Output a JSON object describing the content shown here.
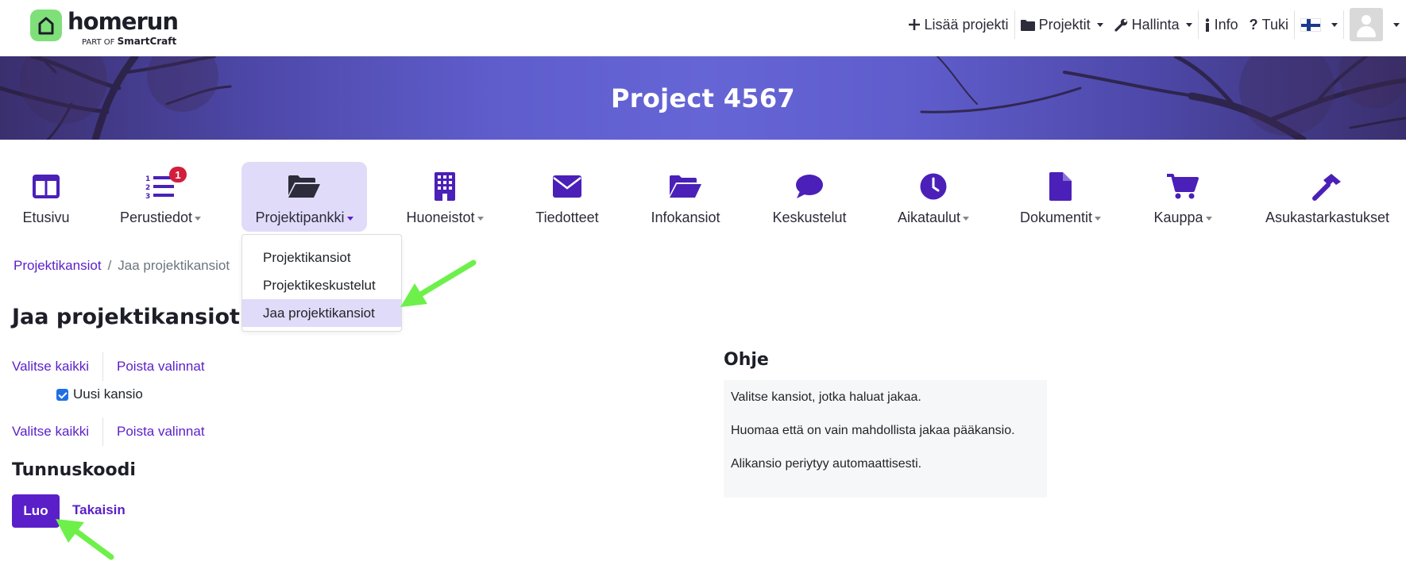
{
  "brand": {
    "name": "homerun",
    "tagline_prefix": "PART OF",
    "tagline_company": "SmartCraft",
    "accent": "#7fe07a"
  },
  "topnav": {
    "items": [
      {
        "label": "Lisää projekti",
        "icon": "plus-icon"
      },
      {
        "label": "Projektit",
        "icon": "folder-icon"
      },
      {
        "label": "Hallinta",
        "icon": "wrench-icon"
      },
      {
        "label": "Info",
        "icon": "info-icon"
      },
      {
        "label": "Tuki",
        "icon": "question-icon"
      }
    ],
    "language_icon": "finnish-flag-icon",
    "user_icon": "user-avatar-icon"
  },
  "hero": {
    "title": "Project 4567"
  },
  "mainnav": {
    "items": [
      {
        "label": "Etusivu",
        "icon": "columns-icon"
      },
      {
        "label": "Perustiedot",
        "icon": "numbered-list-icon",
        "badge": "1"
      },
      {
        "label": "Projektipankki",
        "icon": "folder-open-icon"
      },
      {
        "label": "Huoneistot",
        "icon": "building-icon"
      },
      {
        "label": "Tiedotteet",
        "icon": "envelope-icon"
      },
      {
        "label": "Infokansiot",
        "icon": "folder-open-icon"
      },
      {
        "label": "Keskustelut",
        "icon": "speech-bubble-icon"
      },
      {
        "label": "Aikataulut",
        "icon": "clock-icon"
      },
      {
        "label": "Dokumentit",
        "icon": "file-icon"
      },
      {
        "label": "Kauppa",
        "icon": "cart-icon"
      },
      {
        "label": "Asukastarkastukset",
        "icon": "hammer-icon"
      }
    ],
    "active": "Projektipankki"
  },
  "dropdown": {
    "items": [
      "Projektikansiot",
      "Projektikeskustelut",
      "Jaa projektikansiot"
    ],
    "selected": "Jaa projektikansiot"
  },
  "breadcrumb": {
    "parent": "Projektikansiot",
    "separator": "/",
    "current": "Jaa projektikansiot"
  },
  "page": {
    "title": "Jaa projektikansiot",
    "select_all": "Valitse kaikki",
    "clear_selection": "Poista valinnat",
    "folders": [
      {
        "name": "Uusi kansio",
        "checked": true
      }
    ],
    "code_heading": "Tunnuskoodi",
    "create_button": "Luo",
    "back_link": "Takaisin"
  },
  "help": {
    "title": "Ohje",
    "lines": [
      "Valitse kansiot, jotka haluat jakaa.",
      "Huomaa että on vain mahdollista jakaa pääkansio.",
      "Alikansio periytyy automaattisesti."
    ]
  },
  "colors": {
    "primary": "#5a1fc9",
    "icon": "#4a20b8",
    "active_bg": "#e1dbfa",
    "badge": "#d21f3c",
    "annotation_arrow": "#6ef04a"
  }
}
